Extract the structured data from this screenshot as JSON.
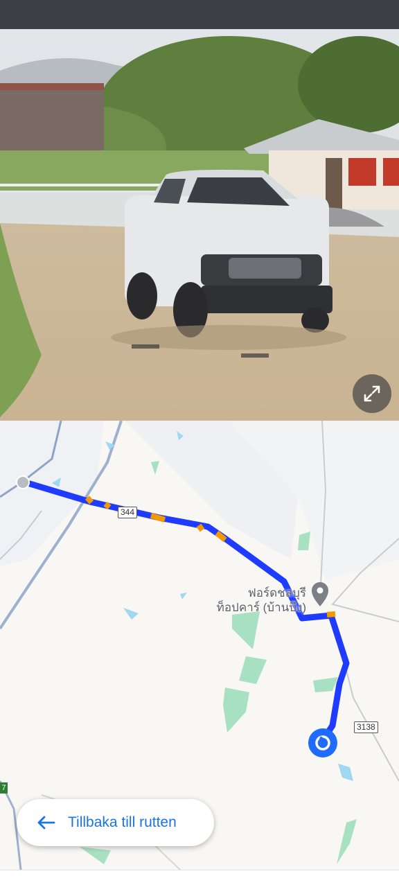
{
  "map": {
    "poi_name_line1": "ฟอร์ดชลบุรี",
    "poi_name_line2": "ท็อปคาร์ (บ้านบึง)",
    "road_344": "344",
    "road_3138": "3138",
    "edge_badge": "7"
  },
  "back_button": {
    "label": "Tillbaka till rutten"
  },
  "icons": {
    "expand": "expand-icon",
    "back": "arrow-left-icon",
    "poi": "location-pin-icon",
    "origin": "route-start-dot",
    "destination": "current-location-icon"
  },
  "colors": {
    "route": "#1f3bff",
    "traffic": "#f29900",
    "accent": "#1a73e8",
    "water": "#9fd8f0",
    "park": "#a8e0c2"
  }
}
